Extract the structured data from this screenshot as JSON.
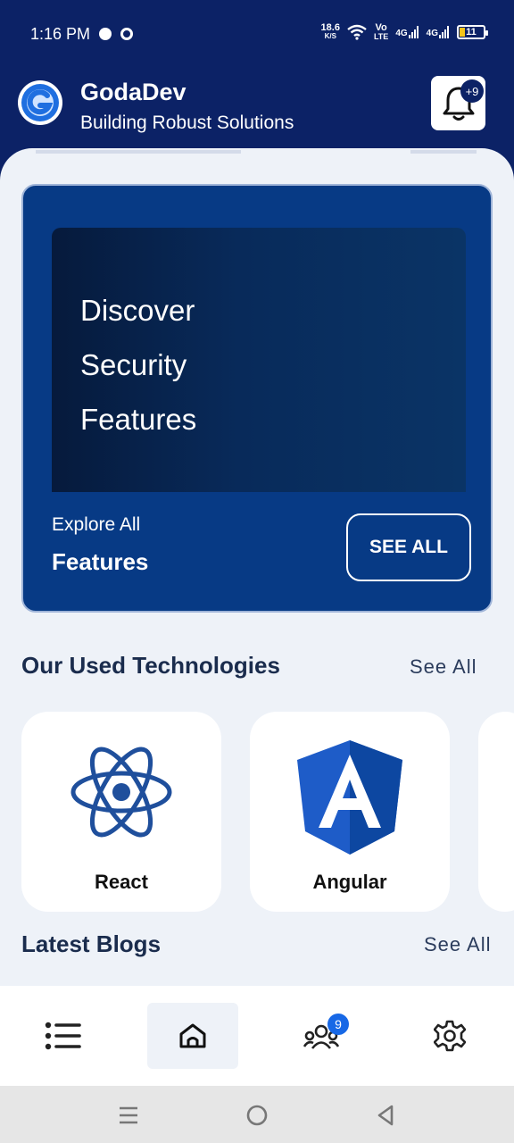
{
  "status_bar": {
    "time": "1:16 PM",
    "net_speed_value": "18.6",
    "net_speed_unit": "K/S",
    "volte_top": "Vo",
    "volte_bottom": "LTE",
    "sim1_label": "4G",
    "sim2_label": "4G",
    "battery_level": "11",
    "icons": [
      "chat-icon",
      "notification-ring-icon",
      "wifi-icon",
      "signal-icon",
      "battery-icon"
    ]
  },
  "header": {
    "app_name": "GodaDev",
    "tagline": "Building Robust Solutions",
    "notification_badge": "+9",
    "colors": {
      "background": "#0c2266",
      "logo_blue": "#1f6fe0"
    }
  },
  "promo": {
    "hero_lines": [
      "Discover",
      "Security",
      "Features"
    ],
    "explore_label": "Explore All",
    "explore_title": "Features",
    "button_label": "SEE ALL",
    "colors": {
      "card": "#073a85"
    }
  },
  "technologies": {
    "title": "Our Used Technologies",
    "see_all": "See All",
    "items": [
      {
        "name": "React",
        "icon": "react-icon",
        "color": "#1f4f9c"
      },
      {
        "name": "Angular",
        "icon": "angular-icon",
        "color": "#0d47a1"
      }
    ]
  },
  "blogs": {
    "title": "Latest Blogs",
    "see_all": "See All"
  },
  "bottom_nav": {
    "items": [
      {
        "icon": "list-icon"
      },
      {
        "icon": "home-icon",
        "active": true
      },
      {
        "icon": "users-icon",
        "badge": "9"
      },
      {
        "icon": "settings-icon"
      }
    ],
    "badge_color": "#1768e6"
  },
  "system_nav": {
    "items": [
      "menu-icon",
      "home-circle-icon",
      "back-icon"
    ]
  }
}
